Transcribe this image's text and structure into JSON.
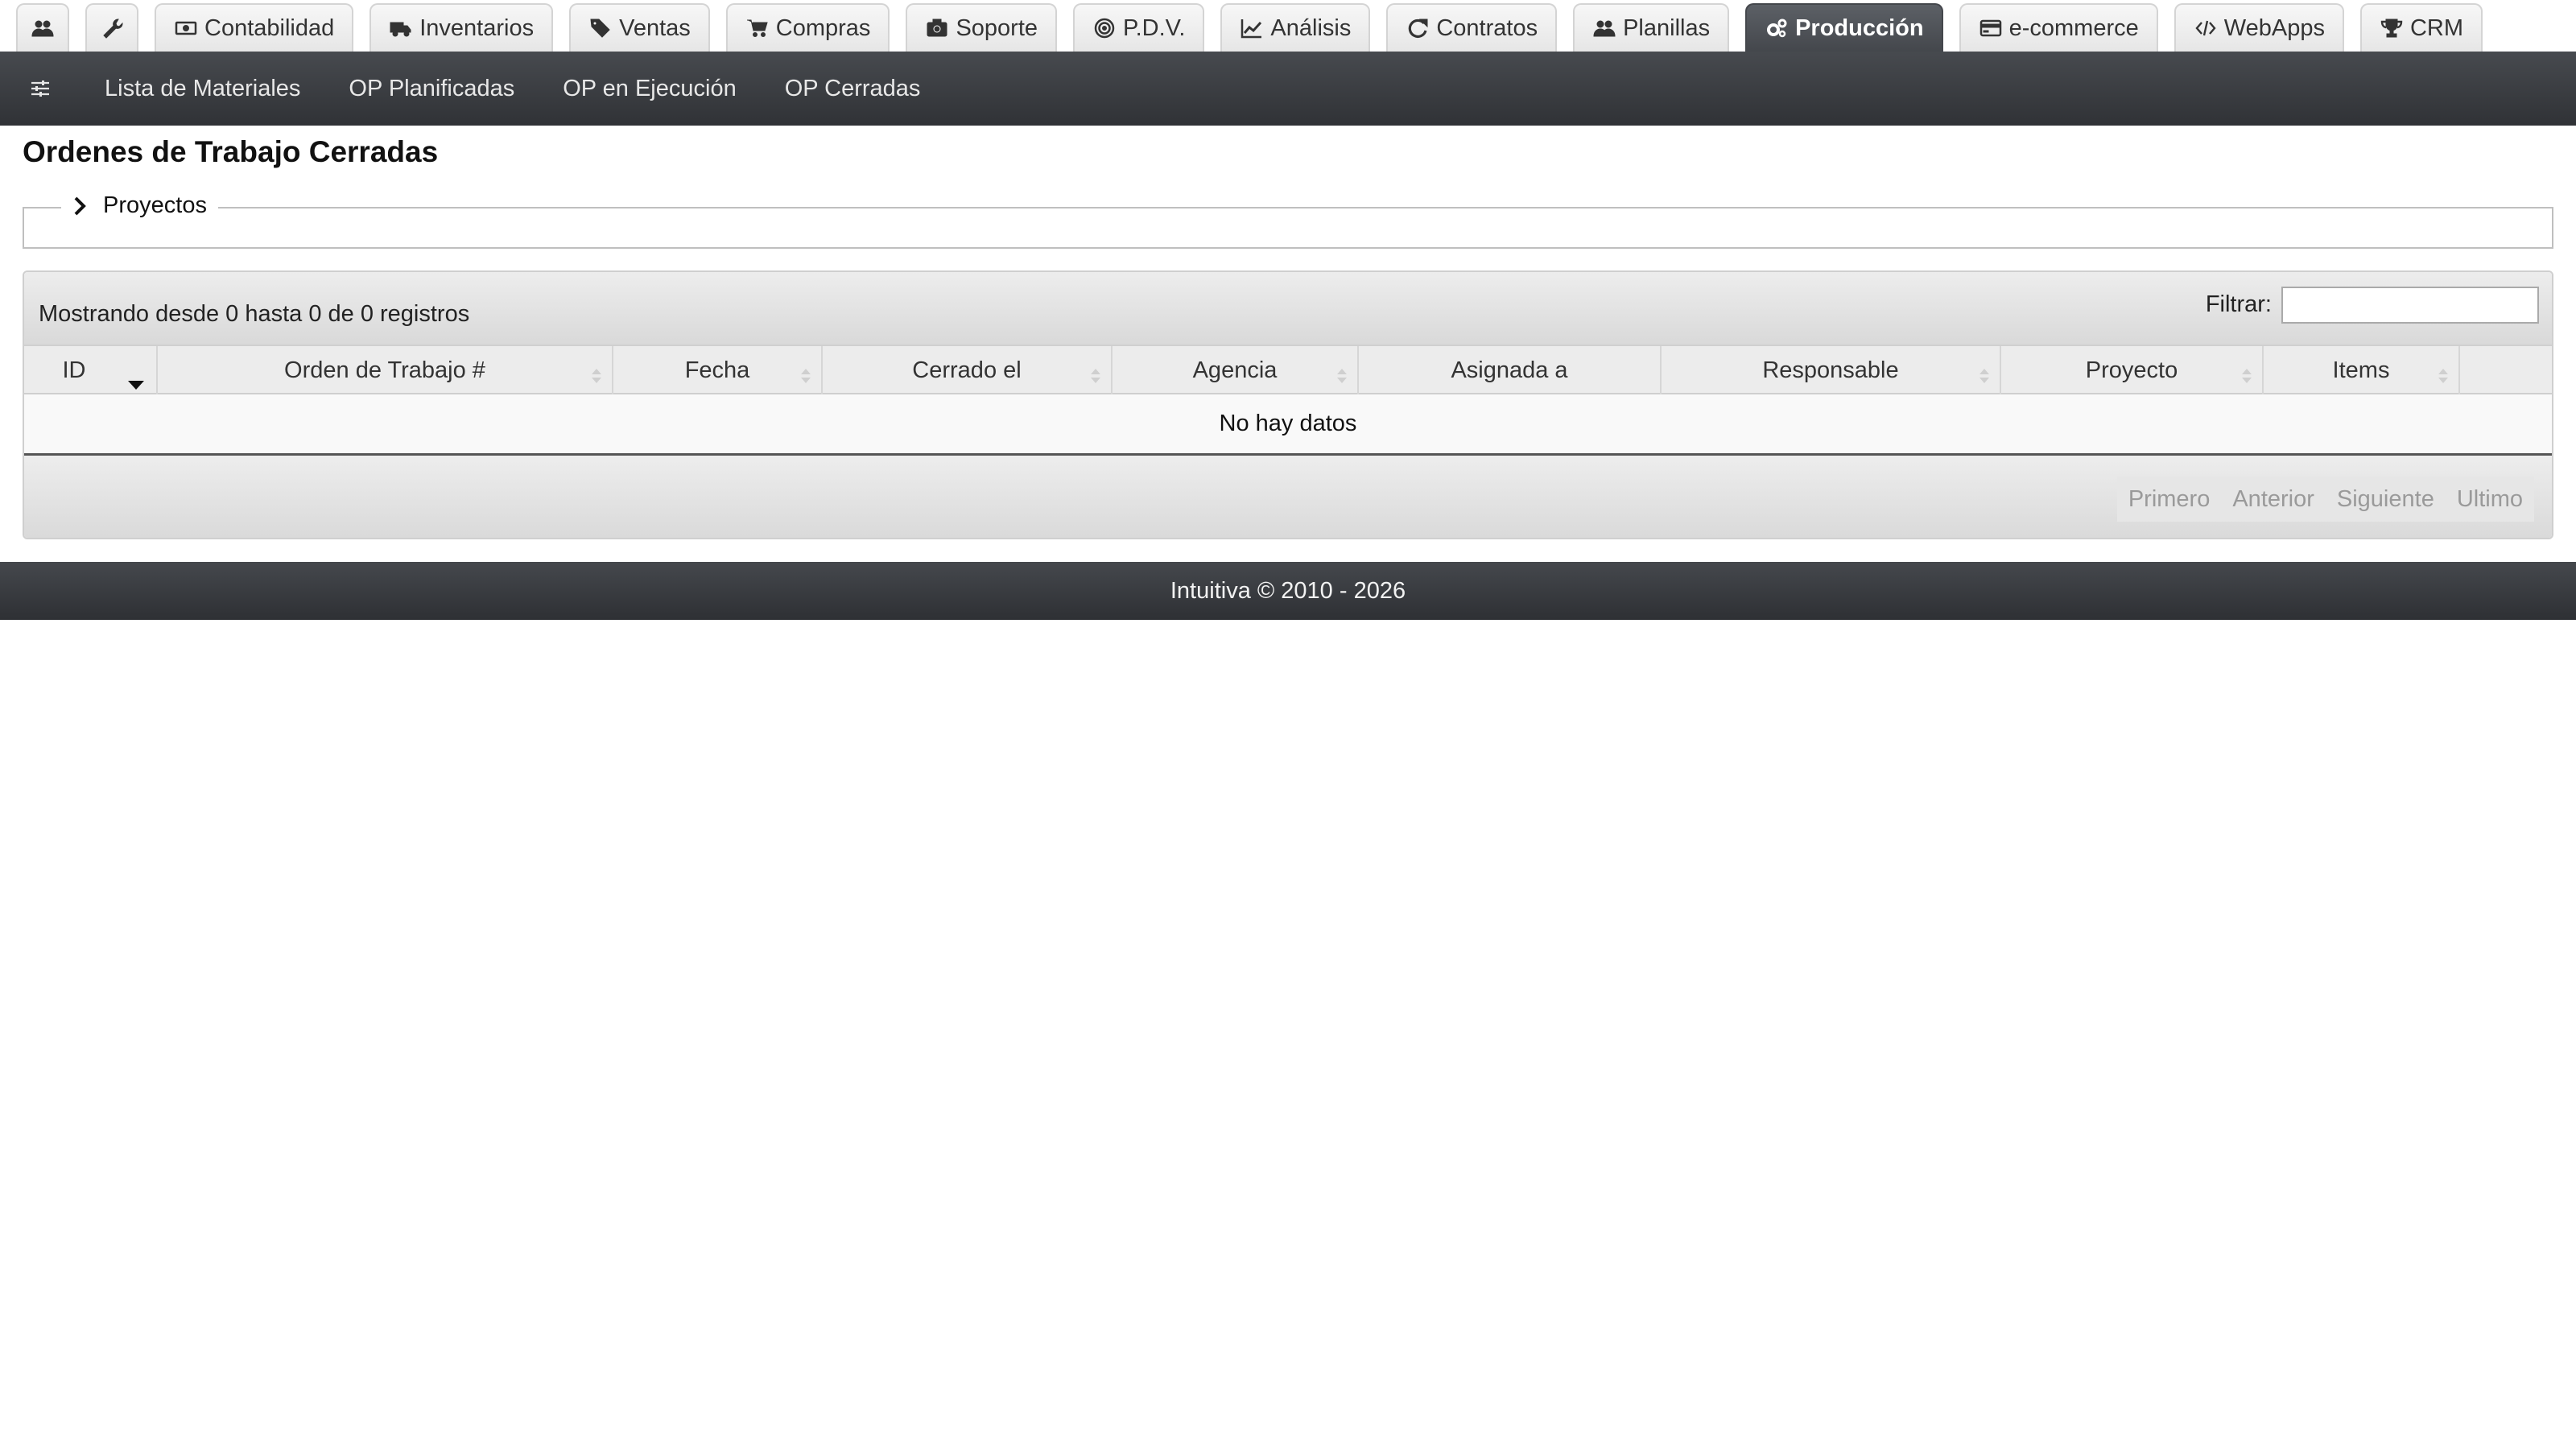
{
  "top_tabs": [
    {
      "label": "",
      "icon": "users-icon"
    },
    {
      "label": "",
      "icon": "wrench-icon"
    },
    {
      "label": "Contabilidad",
      "icon": "money-icon"
    },
    {
      "label": "Inventarios",
      "icon": "truck-icon"
    },
    {
      "label": "Ventas",
      "icon": "tags-icon"
    },
    {
      "label": "Compras",
      "icon": "cart-icon"
    },
    {
      "label": "Soporte",
      "icon": "camera-icon"
    },
    {
      "label": "P.D.V.",
      "icon": "target-icon"
    },
    {
      "label": "Análisis",
      "icon": "chart-icon"
    },
    {
      "label": "Contratos",
      "icon": "refresh-icon"
    },
    {
      "label": "Planillas",
      "icon": "users-icon"
    },
    {
      "label": "Producción",
      "icon": "gears-icon",
      "active": true
    },
    {
      "label": "e-commerce",
      "icon": "credit-card-icon"
    },
    {
      "label": "WebApps",
      "icon": "code-icon"
    },
    {
      "label": "CRM",
      "icon": "trophy-icon"
    }
  ],
  "sub_nav": {
    "items": [
      "Lista de Materiales",
      "OP Planificadas",
      "OP en Ejecución",
      "OP Cerradas"
    ]
  },
  "page": {
    "title": "Ordenes de Trabajo Cerradas",
    "projects_label": "Proyectos"
  },
  "table": {
    "records_info": "Mostrando desde 0 hasta 0 de 0 registros",
    "filter_label": "Filtrar:",
    "filter_value": "",
    "columns": [
      "ID",
      "Orden de Trabajo #",
      "Fecha",
      "Cerrado el",
      "Agencia",
      "Asignada a",
      "Responsable",
      "Proyecto",
      "Items",
      ""
    ],
    "sorted_column": "ID",
    "sorted_direction": "desc",
    "empty_message": "No hay datos",
    "pager": [
      "Primero",
      "Anterior",
      "Siguiente",
      "Ultimo"
    ]
  },
  "footer": {
    "text": "Intuitiva © 2010 - 2026"
  },
  "colors": {
    "active_tab": "#4a4d52",
    "nav_bar": "#3a3c40",
    "footer_bar": "#393b3f"
  }
}
